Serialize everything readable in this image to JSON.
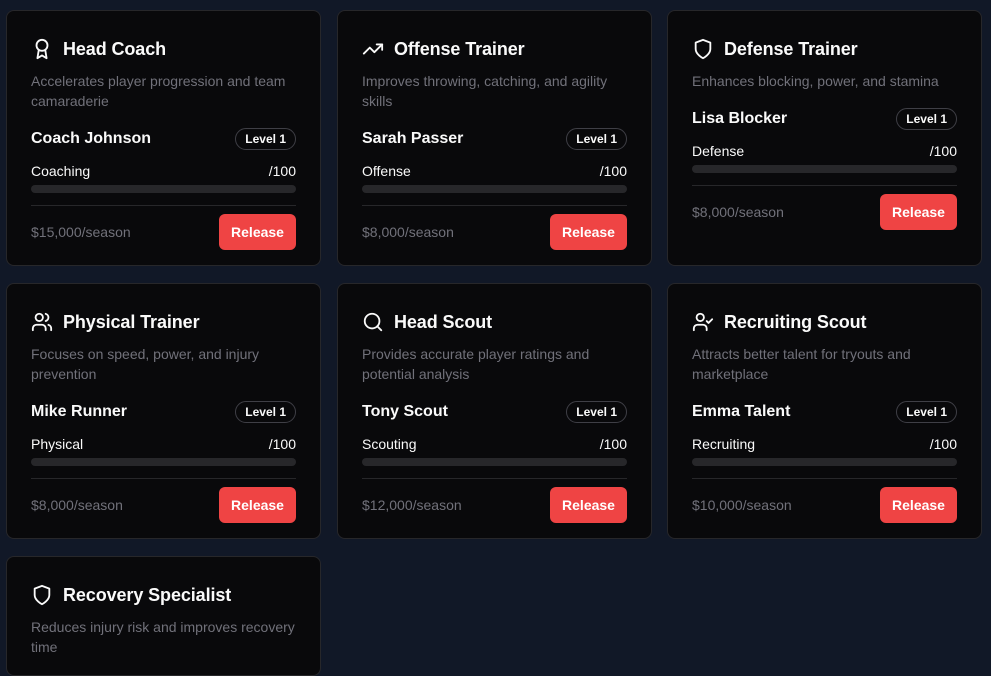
{
  "colors": {
    "accent_release": "#ef4444",
    "background": "#111827",
    "card": "#09090b"
  },
  "cards": [
    {
      "icon": "award-icon",
      "title": "Head Coach",
      "description": "Accelerates player progression and team camaraderie",
      "staff_name": "Coach Johnson",
      "level": "Level 1",
      "stat_label": "Coaching",
      "stat_value": "/100",
      "salary": "$15,000/season",
      "release_label": "Release"
    },
    {
      "icon": "trending-up-icon",
      "title": "Offense Trainer",
      "description": "Improves throwing, catching, and agility skills",
      "staff_name": "Sarah Passer",
      "level": "Level 1",
      "stat_label": "Offense",
      "stat_value": "/100",
      "salary": "$8,000/season",
      "release_label": "Release"
    },
    {
      "icon": "shield-icon",
      "title": "Defense Trainer",
      "description": "Enhances blocking, power, and stamina",
      "staff_name": "Lisa Blocker",
      "level": "Level 1",
      "stat_label": "Defense",
      "stat_value": "/100",
      "salary": "$8,000/season",
      "release_label": "Release"
    },
    {
      "icon": "users-icon",
      "title": "Physical Trainer",
      "description": "Focuses on speed, power, and injury prevention",
      "staff_name": "Mike Runner",
      "level": "Level 1",
      "stat_label": "Physical",
      "stat_value": "/100",
      "salary": "$8,000/season",
      "release_label": "Release"
    },
    {
      "icon": "search-icon",
      "title": "Head Scout",
      "description": "Provides accurate player ratings and potential analysis",
      "staff_name": "Tony Scout",
      "level": "Level 1",
      "stat_label": "Scouting",
      "stat_value": "/100",
      "salary": "$12,000/season",
      "release_label": "Release"
    },
    {
      "icon": "user-check-icon",
      "title": "Recruiting Scout",
      "description": "Attracts better talent for tryouts and marketplace",
      "staff_name": "Emma Talent",
      "level": "Level 1",
      "stat_label": "Recruiting",
      "stat_value": "/100",
      "salary": "$10,000/season",
      "release_label": "Release"
    },
    {
      "icon": "shield-icon",
      "title": "Recovery Specialist",
      "description": "Reduces injury risk and improves recovery time"
    }
  ]
}
